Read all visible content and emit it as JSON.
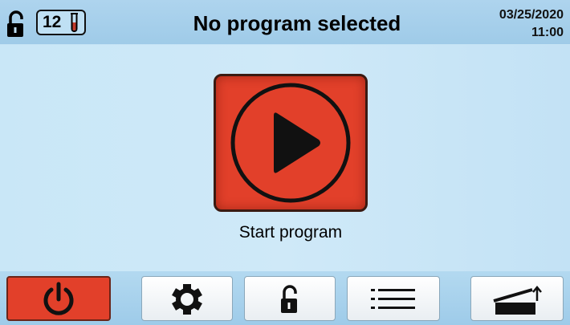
{
  "header": {
    "lock_icon": "unlocked-padlock-icon",
    "rack_count": "12",
    "tube_icon": "test-tube-icon",
    "title": "No program selected",
    "date": "03/25/2020",
    "time": "11:00"
  },
  "main": {
    "start_button_icon": "play-icon",
    "start_label": "Start program"
  },
  "toolbar": {
    "buttons": [
      {
        "icon": "power-icon",
        "active": true
      },
      {
        "icon": "gear-icon"
      },
      {
        "icon": "unlocked-padlock-icon"
      },
      {
        "icon": "list-icon"
      },
      {
        "icon": "open-lid-icon"
      }
    ]
  },
  "colors": {
    "accent_red": "#e2402a",
    "screen_blue": "#c6e4f5",
    "header_blue": "#a6cfeb"
  }
}
